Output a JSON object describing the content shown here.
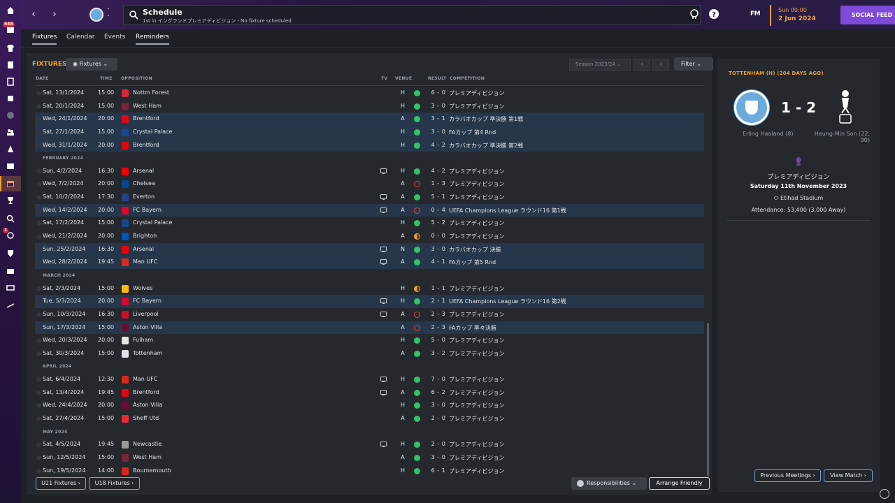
{
  "header": {
    "title": "Schedule",
    "subtitle": "1st in イングランドプレミアディビジョン - No fixture scheduled.",
    "fm_logo": "FM",
    "time": "Sun 00:00",
    "date": "2 Jun 2024",
    "social_feed": "SOCIAL FEED"
  },
  "sidebar": {
    "badges": [
      "548",
      "1"
    ]
  },
  "tabs": [
    {
      "label": "Fixtures",
      "active": true
    },
    {
      "label": "Calendar",
      "active": false
    },
    {
      "label": "Events",
      "active": false
    },
    {
      "label": "Reminders",
      "active": true
    }
  ],
  "fixtures": {
    "title": "FIXTURES",
    "view_dropdown": "Fixtures",
    "season": "Season 2023/24",
    "filter": "Filter",
    "columns": [
      "DATE",
      "TIME",
      "OPPOSITION",
      "TV",
      "VENUE",
      "RESULT",
      "COMPETITION"
    ],
    "rows": [
      {
        "kind": "match",
        "date": "Sat, 13/1/2024",
        "time": "15:00",
        "opp": "Nottm Forest",
        "crest": "#d8273a",
        "tv": false,
        "venue": "H",
        "res": "W",
        "score": "6 - 0",
        "comp": "プレミアディビジョン",
        "cup": false
      },
      {
        "kind": "match",
        "date": "Sat, 20/1/2024",
        "time": "15:00",
        "opp": "West Ham",
        "crest": "#7a263a",
        "tv": false,
        "venue": "H",
        "res": "W",
        "score": "3 - 0",
        "comp": "プレミアディビジョン",
        "cup": false
      },
      {
        "kind": "match",
        "date": "Wed, 24/1/2024",
        "time": "20:00",
        "opp": "Brentford",
        "crest": "#e30613",
        "tv": false,
        "venue": "A",
        "res": "W",
        "score": "3 - 1",
        "comp": "カラバオカップ 準決勝 第1戦",
        "cup": true
      },
      {
        "kind": "match",
        "date": "Sat, 27/1/2024",
        "time": "15:00",
        "opp": "Crystal Palace",
        "crest": "#1b458f",
        "tv": false,
        "venue": "H",
        "res": "W",
        "score": "3 - 0",
        "comp": "FAカップ 第4 Rnd",
        "cup": true
      },
      {
        "kind": "match",
        "date": "Wed, 31/1/2024",
        "time": "20:00",
        "opp": "Brentford",
        "crest": "#e30613",
        "tv": false,
        "venue": "H",
        "res": "W",
        "score": "4 - 2",
        "comp": "カラバオカップ 準決勝 第2戦",
        "cup": true
      },
      {
        "kind": "month",
        "label": "FEBRUARY 2024"
      },
      {
        "kind": "match",
        "date": "Sun, 4/2/2024",
        "time": "16:30",
        "opp": "Arsenal",
        "crest": "#ef0107",
        "tv": true,
        "venue": "H",
        "res": "W",
        "score": "4 - 2",
        "comp": "プレミアディビジョン",
        "cup": false
      },
      {
        "kind": "match",
        "date": "Wed, 7/2/2024",
        "time": "20:00",
        "opp": "Chelsea",
        "crest": "#034694",
        "tv": false,
        "venue": "A",
        "res": "L",
        "score": "1 - 3",
        "comp": "プレミアディビジョン",
        "cup": false
      },
      {
        "kind": "match",
        "date": "Sat, 10/2/2024",
        "time": "17:30",
        "opp": "Everton",
        "crest": "#274488",
        "tv": true,
        "venue": "A",
        "res": "W",
        "score": "5 - 1",
        "comp": "プレミアディビジョン",
        "cup": false
      },
      {
        "kind": "match",
        "date": "Wed, 14/2/2024",
        "time": "20:00",
        "opp": "FC Bayern",
        "crest": "#dc052d",
        "tv": true,
        "venue": "A",
        "res": "L",
        "score": "0 - 4",
        "comp": "UEFA Champions League ラウンド16 第1戦",
        "cup": true
      },
      {
        "kind": "match",
        "date": "Sat, 17/2/2024",
        "time": "15:00",
        "opp": "Crystal Palace",
        "crest": "#1b458f",
        "tv": false,
        "venue": "H",
        "res": "W",
        "score": "5 - 2",
        "comp": "プレミアディビジョン",
        "cup": false
      },
      {
        "kind": "match",
        "date": "Wed, 21/2/2024",
        "time": "20:00",
        "opp": "Brighton",
        "crest": "#0057b8",
        "tv": false,
        "venue": "A",
        "res": "D",
        "score": "0 - 0",
        "comp": "プレミアディビジョン",
        "cup": false
      },
      {
        "kind": "match",
        "date": "Sun, 25/2/2024",
        "time": "16:30",
        "opp": "Arsenal",
        "crest": "#ef0107",
        "tv": true,
        "venue": "N",
        "res": "W",
        "score": "3 - 0",
        "comp": "カラバオカップ 決勝",
        "cup": true
      },
      {
        "kind": "match",
        "date": "Wed, 28/2/2024",
        "time": "19:45",
        "opp": "Man UFC",
        "crest": "#da291c",
        "tv": true,
        "venue": "A",
        "res": "W",
        "score": "4 - 1",
        "comp": "FAカップ 第5 Rnd",
        "cup": true
      },
      {
        "kind": "month",
        "label": "MARCH 2024"
      },
      {
        "kind": "match",
        "date": "Sat, 2/3/2024",
        "time": "15:00",
        "opp": "Wolves",
        "crest": "#fdb913",
        "tv": false,
        "venue": "H",
        "res": "D",
        "score": "1 - 1",
        "comp": "プレミアディビジョン",
        "cup": false
      },
      {
        "kind": "match",
        "date": "Tue, 5/3/2024",
        "time": "20:00",
        "opp": "FC Bayern",
        "crest": "#dc052d",
        "tv": true,
        "venue": "H",
        "res": "W",
        "score": "2 - 1",
        "comp": "UEFA Champions League ラウンド16 第2戦",
        "cup": true
      },
      {
        "kind": "match",
        "date": "Sun, 10/3/2024",
        "time": "16:30",
        "opp": "Liverpool",
        "crest": "#c8102e",
        "tv": true,
        "venue": "A",
        "res": "L",
        "score": "2 - 3",
        "comp": "プレミアディビジョン",
        "cup": false
      },
      {
        "kind": "match",
        "date": "Sun, 17/3/2024",
        "time": "15:00",
        "opp": "Aston Villa",
        "crest": "#670e36",
        "tv": false,
        "venue": "A",
        "res": "L",
        "score": "2 - 3",
        "comp": "FAカップ 準々決勝",
        "cup": true
      },
      {
        "kind": "match",
        "date": "Wed, 20/3/2024",
        "time": "20:00",
        "opp": "Fulham",
        "crest": "#e6e6e6",
        "tv": false,
        "venue": "H",
        "res": "W",
        "score": "5 - 0",
        "comp": "プレミアディビジョン",
        "cup": false
      },
      {
        "kind": "match",
        "date": "Sat, 30/3/2024",
        "time": "15:00",
        "opp": "Tottenham",
        "crest": "#dfe2ea",
        "tv": false,
        "venue": "A",
        "res": "W",
        "score": "3 - 2",
        "comp": "プレミアディビジョン",
        "cup": false
      },
      {
        "kind": "month",
        "label": "APRIL 2024"
      },
      {
        "kind": "match",
        "date": "Sat, 6/4/2024",
        "time": "12:30",
        "opp": "Man UFC",
        "crest": "#da291c",
        "tv": true,
        "venue": "H",
        "res": "W",
        "score": "7 - 0",
        "comp": "プレミアディビジョン",
        "cup": false
      },
      {
        "kind": "match",
        "date": "Sat, 13/4/2024",
        "time": "19:45",
        "opp": "Brentford",
        "crest": "#e30613",
        "tv": true,
        "venue": "A",
        "res": "W",
        "score": "6 - 2",
        "comp": "プレミアディビジョン",
        "cup": false
      },
      {
        "kind": "match",
        "date": "Wed, 24/4/2024",
        "time": "20:00",
        "opp": "Aston Villa",
        "crest": "#670e36",
        "tv": false,
        "venue": "H",
        "res": "W",
        "score": "3 - 0",
        "comp": "プレミアディビジョン",
        "cup": false
      },
      {
        "kind": "match",
        "date": "Sat, 27/4/2024",
        "time": "15:00",
        "opp": "Sheff Utd",
        "crest": "#ee2737",
        "tv": false,
        "venue": "A",
        "res": "W",
        "score": "2 - 0",
        "comp": "プレミアディビジョン",
        "cup": false
      },
      {
        "kind": "month",
        "label": "MAY 2024"
      },
      {
        "kind": "match",
        "date": "Sat, 4/5/2024",
        "time": "19:45",
        "opp": "Newcastle",
        "crest": "#9a9a9a",
        "tv": true,
        "venue": "H",
        "res": "W",
        "score": "2 - 0",
        "comp": "プレミアディビジョン",
        "cup": false
      },
      {
        "kind": "match",
        "date": "Sun, 12/5/2024",
        "time": "15:00",
        "opp": "West Ham",
        "crest": "#7a263a",
        "tv": false,
        "venue": "A",
        "res": "W",
        "score": "3 - 0",
        "comp": "プレミアディビジョン",
        "cup": false
      },
      {
        "kind": "match",
        "date": "Sun, 19/5/2024",
        "time": "14:00",
        "opp": "Bournemouth",
        "crest": "#da291c",
        "tv": false,
        "venue": "H",
        "res": "W",
        "score": "6 - 1",
        "comp": "プレミアディビジョン",
        "cup": false
      }
    ],
    "buttons": {
      "u21": "U21 Fixtures",
      "u18": "U18 Fixtures",
      "responsibilities": "Responsibilities",
      "arrange": "Arrange Friendly"
    }
  },
  "match_detail": {
    "title": "TOTTENHAM (H) (204 DAYS AGO)",
    "score": "1 - 2",
    "home_scorers": "Erling Haaland (8)",
    "away_scorers": "Heung-Min Son (22, 90)",
    "competition": "プレミアディビジョン",
    "date": "Saturday 11th November 2023",
    "stadium": "Etihad Stadium",
    "attendance": "Attendance: 53,400 (3,000 Away)",
    "prev_meetings": "Previous Meetings",
    "view_match": "View Match"
  }
}
